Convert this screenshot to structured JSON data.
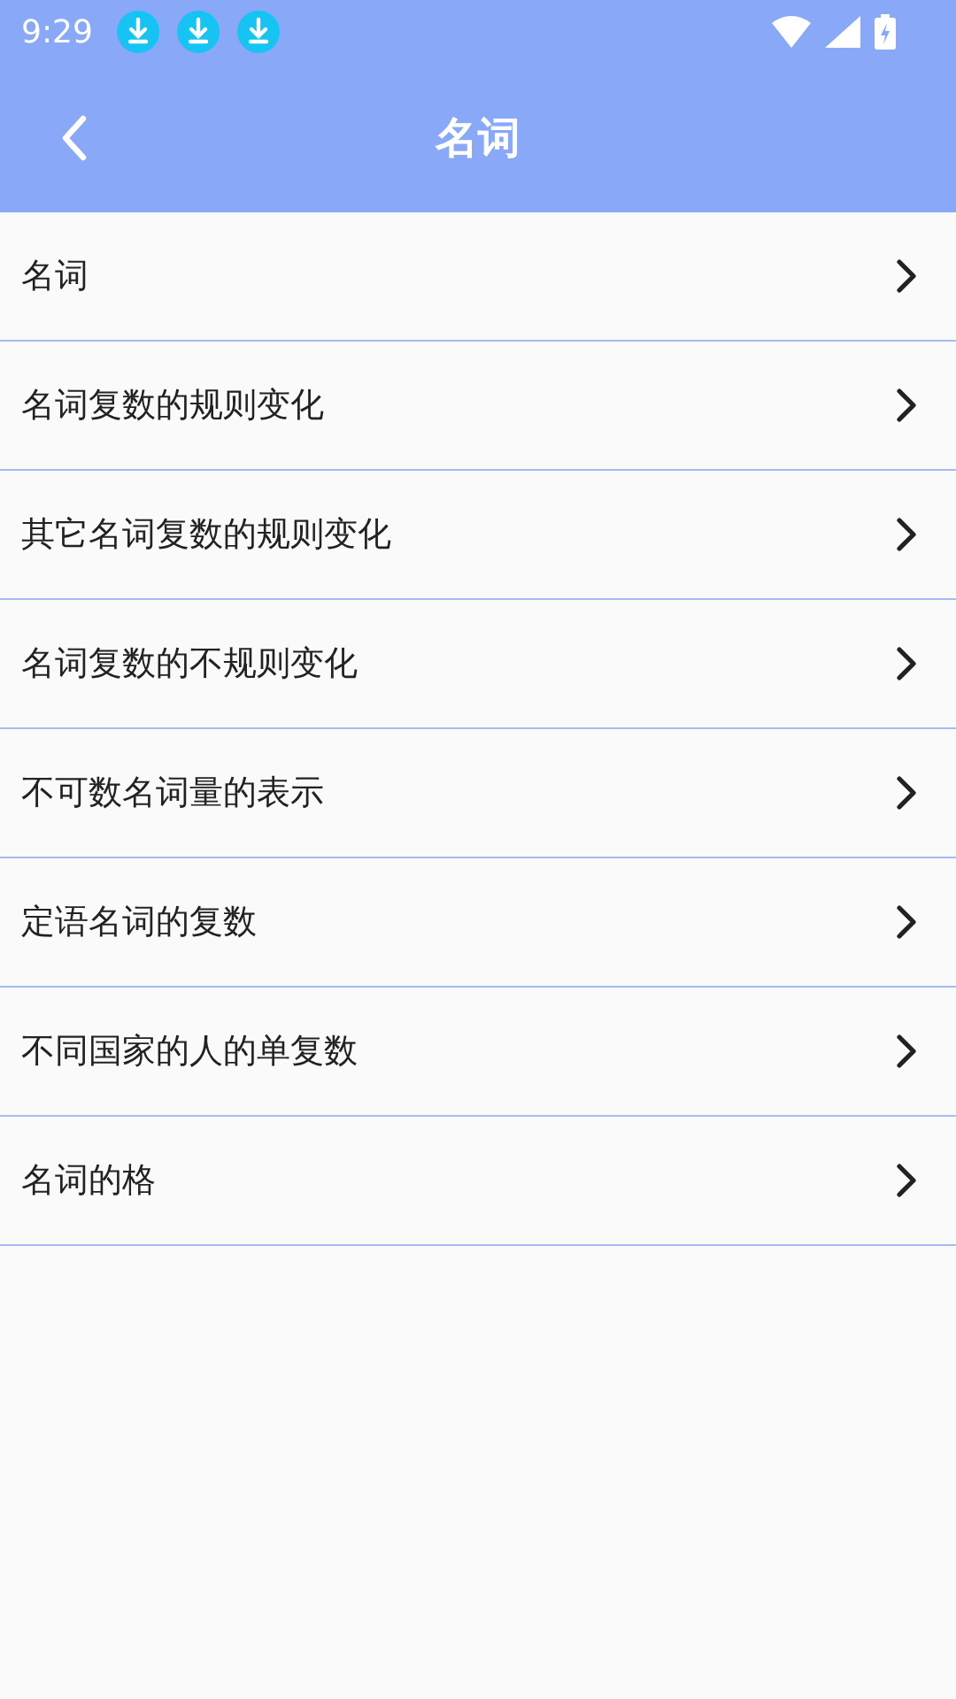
{
  "status_bar": {
    "time": "9:29",
    "notifications": [
      {
        "kind": "download"
      },
      {
        "kind": "download"
      },
      {
        "kind": "download"
      }
    ]
  },
  "header": {
    "title": "名词"
  },
  "items": [
    {
      "label": "名词"
    },
    {
      "label": "名词复数的规则变化"
    },
    {
      "label": "其它名词复数的规则变化"
    },
    {
      "label": "名词复数的不规则变化"
    },
    {
      "label": "不可数名词量的表示"
    },
    {
      "label": "定语名词的复数"
    },
    {
      "label": "不同国家的人的单复数"
    },
    {
      "label": "名词的格"
    }
  ]
}
